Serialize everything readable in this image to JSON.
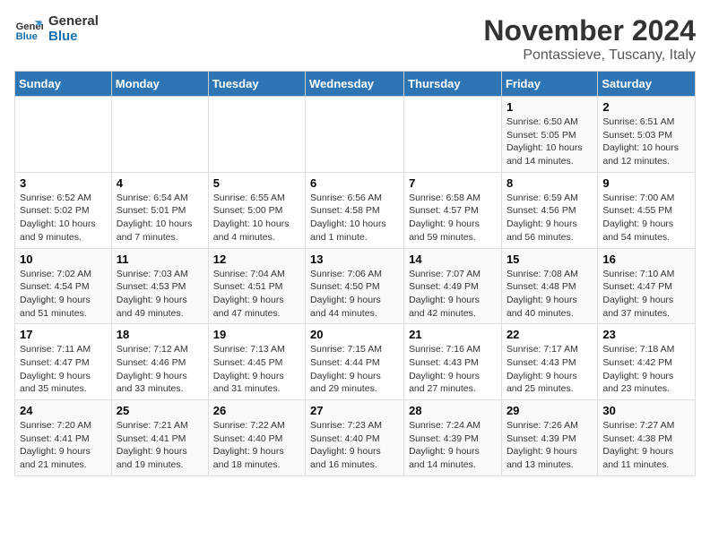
{
  "logo": {
    "line1": "General",
    "line2": "Blue"
  },
  "title": "November 2024",
  "subtitle": "Pontassieve, Tuscany, Italy",
  "weekdays": [
    "Sunday",
    "Monday",
    "Tuesday",
    "Wednesday",
    "Thursday",
    "Friday",
    "Saturday"
  ],
  "weeks": [
    [
      {
        "day": "",
        "sunrise": "",
        "sunset": "",
        "daylight": ""
      },
      {
        "day": "",
        "sunrise": "",
        "sunset": "",
        "daylight": ""
      },
      {
        "day": "",
        "sunrise": "",
        "sunset": "",
        "daylight": ""
      },
      {
        "day": "",
        "sunrise": "",
        "sunset": "",
        "daylight": ""
      },
      {
        "day": "",
        "sunrise": "",
        "sunset": "",
        "daylight": ""
      },
      {
        "day": "1",
        "sunrise": "Sunrise: 6:50 AM",
        "sunset": "Sunset: 5:05 PM",
        "daylight": "Daylight: 10 hours and 14 minutes."
      },
      {
        "day": "2",
        "sunrise": "Sunrise: 6:51 AM",
        "sunset": "Sunset: 5:03 PM",
        "daylight": "Daylight: 10 hours and 12 minutes."
      }
    ],
    [
      {
        "day": "3",
        "sunrise": "Sunrise: 6:52 AM",
        "sunset": "Sunset: 5:02 PM",
        "daylight": "Daylight: 10 hours and 9 minutes."
      },
      {
        "day": "4",
        "sunrise": "Sunrise: 6:54 AM",
        "sunset": "Sunset: 5:01 PM",
        "daylight": "Daylight: 10 hours and 7 minutes."
      },
      {
        "day": "5",
        "sunrise": "Sunrise: 6:55 AM",
        "sunset": "Sunset: 5:00 PM",
        "daylight": "Daylight: 10 hours and 4 minutes."
      },
      {
        "day": "6",
        "sunrise": "Sunrise: 6:56 AM",
        "sunset": "Sunset: 4:58 PM",
        "daylight": "Daylight: 10 hours and 1 minute."
      },
      {
        "day": "7",
        "sunrise": "Sunrise: 6:58 AM",
        "sunset": "Sunset: 4:57 PM",
        "daylight": "Daylight: 9 hours and 59 minutes."
      },
      {
        "day": "8",
        "sunrise": "Sunrise: 6:59 AM",
        "sunset": "Sunset: 4:56 PM",
        "daylight": "Daylight: 9 hours and 56 minutes."
      },
      {
        "day": "9",
        "sunrise": "Sunrise: 7:00 AM",
        "sunset": "Sunset: 4:55 PM",
        "daylight": "Daylight: 9 hours and 54 minutes."
      }
    ],
    [
      {
        "day": "10",
        "sunrise": "Sunrise: 7:02 AM",
        "sunset": "Sunset: 4:54 PM",
        "daylight": "Daylight: 9 hours and 51 minutes."
      },
      {
        "day": "11",
        "sunrise": "Sunrise: 7:03 AM",
        "sunset": "Sunset: 4:53 PM",
        "daylight": "Daylight: 9 hours and 49 minutes."
      },
      {
        "day": "12",
        "sunrise": "Sunrise: 7:04 AM",
        "sunset": "Sunset: 4:51 PM",
        "daylight": "Daylight: 9 hours and 47 minutes."
      },
      {
        "day": "13",
        "sunrise": "Sunrise: 7:06 AM",
        "sunset": "Sunset: 4:50 PM",
        "daylight": "Daylight: 9 hours and 44 minutes."
      },
      {
        "day": "14",
        "sunrise": "Sunrise: 7:07 AM",
        "sunset": "Sunset: 4:49 PM",
        "daylight": "Daylight: 9 hours and 42 minutes."
      },
      {
        "day": "15",
        "sunrise": "Sunrise: 7:08 AM",
        "sunset": "Sunset: 4:48 PM",
        "daylight": "Daylight: 9 hours and 40 minutes."
      },
      {
        "day": "16",
        "sunrise": "Sunrise: 7:10 AM",
        "sunset": "Sunset: 4:47 PM",
        "daylight": "Daylight: 9 hours and 37 minutes."
      }
    ],
    [
      {
        "day": "17",
        "sunrise": "Sunrise: 7:11 AM",
        "sunset": "Sunset: 4:47 PM",
        "daylight": "Daylight: 9 hours and 35 minutes."
      },
      {
        "day": "18",
        "sunrise": "Sunrise: 7:12 AM",
        "sunset": "Sunset: 4:46 PM",
        "daylight": "Daylight: 9 hours and 33 minutes."
      },
      {
        "day": "19",
        "sunrise": "Sunrise: 7:13 AM",
        "sunset": "Sunset: 4:45 PM",
        "daylight": "Daylight: 9 hours and 31 minutes."
      },
      {
        "day": "20",
        "sunrise": "Sunrise: 7:15 AM",
        "sunset": "Sunset: 4:44 PM",
        "daylight": "Daylight: 9 hours and 29 minutes."
      },
      {
        "day": "21",
        "sunrise": "Sunrise: 7:16 AM",
        "sunset": "Sunset: 4:43 PM",
        "daylight": "Daylight: 9 hours and 27 minutes."
      },
      {
        "day": "22",
        "sunrise": "Sunrise: 7:17 AM",
        "sunset": "Sunset: 4:43 PM",
        "daylight": "Daylight: 9 hours and 25 minutes."
      },
      {
        "day": "23",
        "sunrise": "Sunrise: 7:18 AM",
        "sunset": "Sunset: 4:42 PM",
        "daylight": "Daylight: 9 hours and 23 minutes."
      }
    ],
    [
      {
        "day": "24",
        "sunrise": "Sunrise: 7:20 AM",
        "sunset": "Sunset: 4:41 PM",
        "daylight": "Daylight: 9 hours and 21 minutes."
      },
      {
        "day": "25",
        "sunrise": "Sunrise: 7:21 AM",
        "sunset": "Sunset: 4:41 PM",
        "daylight": "Daylight: 9 hours and 19 minutes."
      },
      {
        "day": "26",
        "sunrise": "Sunrise: 7:22 AM",
        "sunset": "Sunset: 4:40 PM",
        "daylight": "Daylight: 9 hours and 18 minutes."
      },
      {
        "day": "27",
        "sunrise": "Sunrise: 7:23 AM",
        "sunset": "Sunset: 4:40 PM",
        "daylight": "Daylight: 9 hours and 16 minutes."
      },
      {
        "day": "28",
        "sunrise": "Sunrise: 7:24 AM",
        "sunset": "Sunset: 4:39 PM",
        "daylight": "Daylight: 9 hours and 14 minutes."
      },
      {
        "day": "29",
        "sunrise": "Sunrise: 7:26 AM",
        "sunset": "Sunset: 4:39 PM",
        "daylight": "Daylight: 9 hours and 13 minutes."
      },
      {
        "day": "30",
        "sunrise": "Sunrise: 7:27 AM",
        "sunset": "Sunset: 4:38 PM",
        "daylight": "Daylight: 9 hours and 11 minutes."
      }
    ]
  ]
}
